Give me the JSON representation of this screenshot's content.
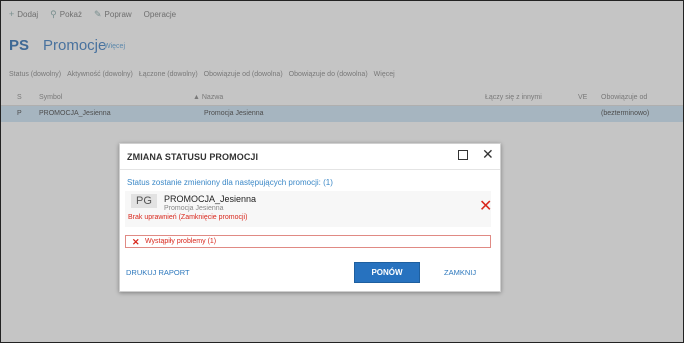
{
  "toolbar": {
    "items": [
      {
        "icon": "plus-icon",
        "glyph": "+",
        "label": "Dodaj"
      },
      {
        "icon": "search-icon",
        "glyph": "⚲",
        "label": "Pokaż"
      },
      {
        "icon": "pencil-icon",
        "glyph": "✎",
        "label": "Popraw"
      },
      {
        "icon": "none",
        "glyph": "",
        "label": "Operacje"
      }
    ]
  },
  "header": {
    "badge": "PS",
    "title": "Promocje",
    "more": "Więcej"
  },
  "filters": [
    "Status (dowolny)",
    "Aktywność (dowolny)",
    "Łączone (dowolny)",
    "Obowiązuje od (dowolna)",
    "Obowiązuje do (dowolna)",
    "Więcej"
  ],
  "grid": {
    "columns": [
      "S",
      "Symbol",
      "▲ Nazwa",
      "Łączy się z innymi",
      "VE",
      "Obowiązuje od"
    ],
    "row": [
      "P",
      "PROMOCJA_Jesienna",
      "Promocja Jesienna",
      "",
      "",
      "(bezterminowo)"
    ]
  },
  "dialog": {
    "title": "ZMIANA STATUSU PROMOCJI",
    "info": "Status zostanie zmieniony dla następujących promocji: (1)",
    "promo": {
      "badge": "PG",
      "symbol": "PROMOCJA_Jesienna",
      "name": "Promocja Jesienna",
      "error": "Brak uprawnień (Zamknięcie promocji)"
    },
    "problem": "Wystąpiły problemy (1)",
    "buttons": {
      "print": "DRUKUJ RAPORT",
      "retry": "PONÓW",
      "close": "ZAMKNIJ"
    }
  },
  "colors": {
    "accent": "#2772bf",
    "error": "#d9281d",
    "selected_row": "#cfe6f7"
  }
}
